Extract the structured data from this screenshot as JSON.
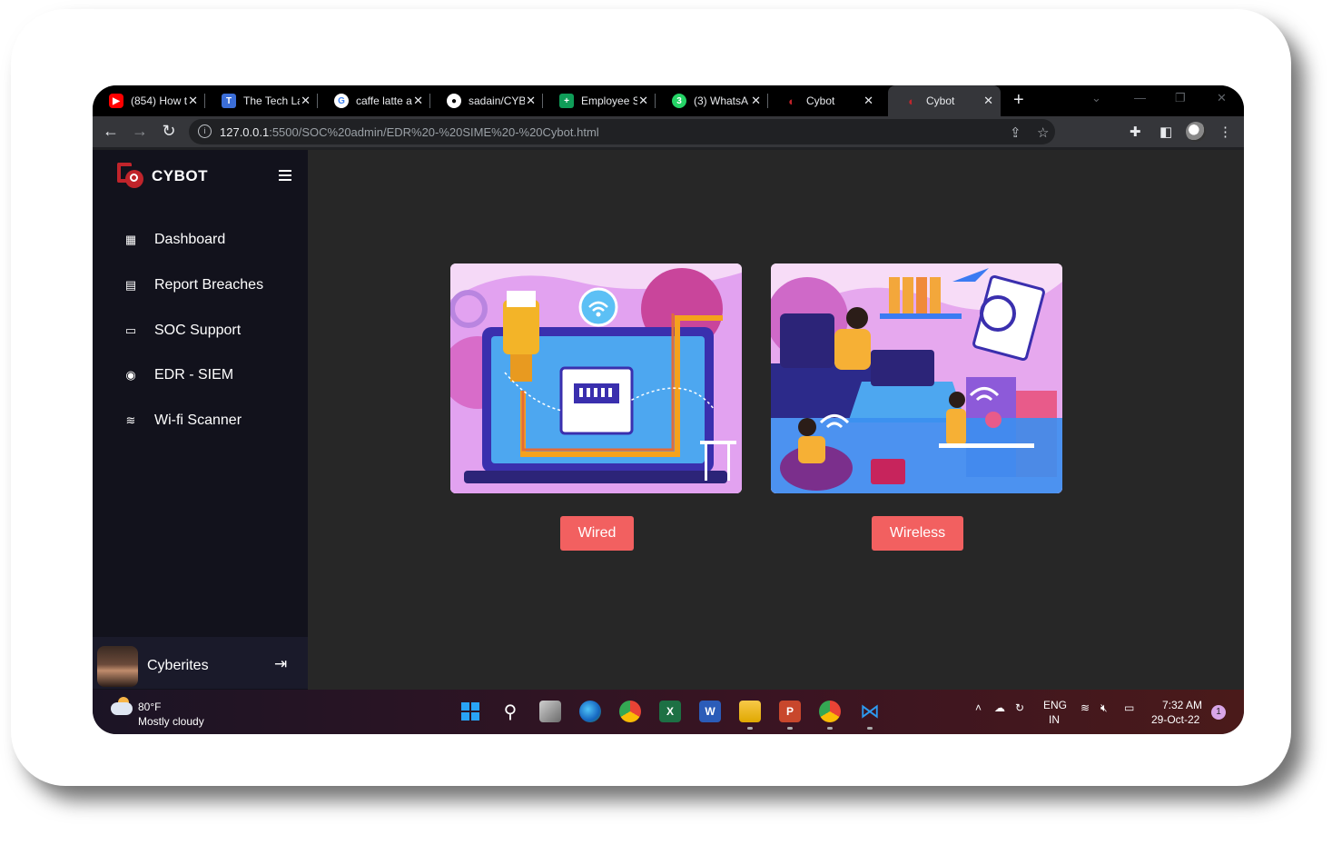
{
  "browser": {
    "tabs": [
      {
        "label": "(854) How t",
        "icon": "youtube-icon",
        "color": "#ff0000"
      },
      {
        "label": "The Tech La",
        "icon": "techlab-icon",
        "color": "#3b6ed8"
      },
      {
        "label": "caffe latte a",
        "icon": "google-icon",
        "color": "#ffffff"
      },
      {
        "label": "sadain/CYB",
        "icon": "github-icon",
        "color": "#ffffff"
      },
      {
        "label": "Employee S",
        "icon": "sheets-icon",
        "color": "#0f9d58"
      },
      {
        "label": "(3) WhatsA",
        "icon": "whatsapp-icon",
        "color": "#25d366"
      },
      {
        "label": "Cybot",
        "icon": "cybot-icon",
        "color": "#c0242b"
      },
      {
        "label": "Cybot",
        "icon": "cybot-icon",
        "color": "#c0242b"
      }
    ],
    "url_host": "127.0.0.1",
    "url_path": ":5500/SOC%20admin/EDR%20-%20SIME%20-%20Cybot.html"
  },
  "app": {
    "logo_text": "CYBOT",
    "nav": [
      {
        "label": "Dashboard",
        "icon": "dashboard-icon"
      },
      {
        "label": "Report Breaches",
        "icon": "report-icon"
      },
      {
        "label": "SOC Support",
        "icon": "support-icon"
      },
      {
        "label": "EDR - SIEM",
        "icon": "edr-icon"
      },
      {
        "label": "Wi-fi Scanner",
        "icon": "wifi-icon"
      }
    ],
    "user": {
      "name": "Cyberites"
    },
    "cards": [
      {
        "button": "Wired",
        "image": "wired-network-illustration"
      },
      {
        "button": "Wireless",
        "image": "wireless-network-illustration"
      }
    ],
    "accent": "#f26060"
  },
  "taskbar": {
    "weather_temp": "80°F",
    "weather_cond": "Mostly cloudy",
    "lang_top": "ENG",
    "lang_bottom": "IN",
    "time": "7:32 AM",
    "date": "29-Oct-22",
    "notification_count": "1"
  }
}
